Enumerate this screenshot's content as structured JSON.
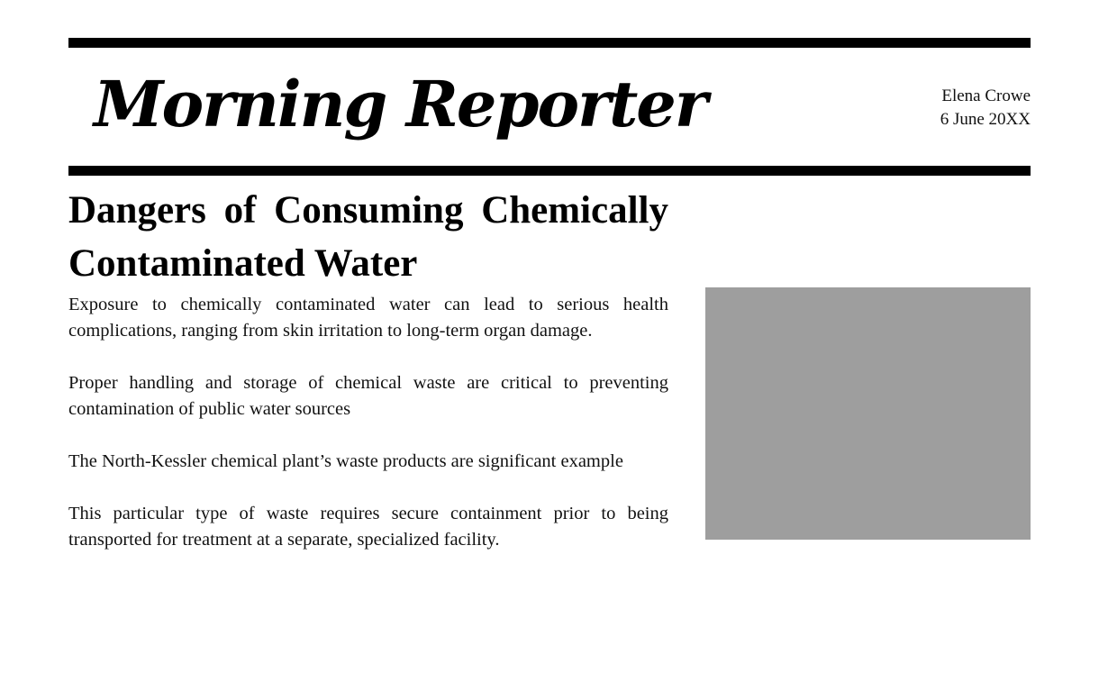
{
  "masthead": {
    "title": "Morning Reporter",
    "author": "Elena Crowe",
    "date": "6 June 20XX"
  },
  "article": {
    "headline": "Dangers of Consuming Chemically Contaminated Water",
    "paragraphs": [
      "Exposure to chemically contaminated water can lead to serious health complications, ranging from skin irritation to long-term organ damage.",
      "Proper handling and storage of chemical waste are critical to preventing contamination of public water sources",
      "The North-Kessler chemical plant’s waste products are significant example",
      "This particular type of waste requires secure containment prior to being transported for treatment at a separate, specialized facility."
    ]
  },
  "colors": {
    "rule": "#000000",
    "photo_placeholder": "#9e9e9e"
  }
}
